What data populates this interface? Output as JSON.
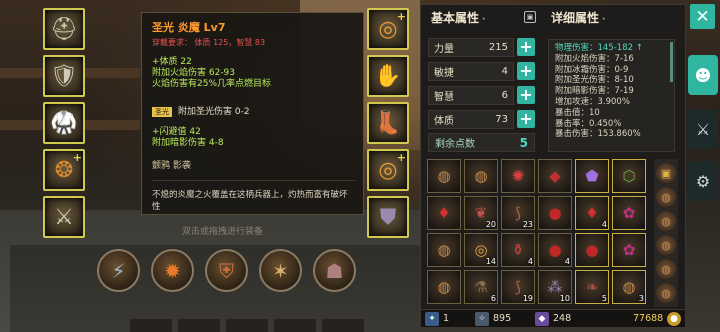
{
  "tooltip": {
    "title": "圣光 炎魔 Lv7",
    "requirement": "穿戴要求：  体质 125，智慧 83",
    "stats": [
      "+体质 22",
      "附加火焰伤害 62-93",
      "火焰伤害有25%几率点燃目标"
    ],
    "gem_tag": "圣光",
    "gem_text": "附加圣光伤害 0-2",
    "stats2": [
      "+闪避值 42",
      "附加暗影伤害 4-8"
    ],
    "sockets": "颤鸦  影袭",
    "description": "不熄的炎魔之火覆盖在这柄兵器上，灼热而富有破坏性",
    "hint": "双击或拖拽进行装备"
  },
  "left_slots": [
    {
      "icon": "helmet-icon",
      "label": "头盔"
    },
    {
      "icon": "shoulder-armor-icon",
      "label": "肩甲"
    },
    {
      "icon": "chest-armor-icon",
      "label": "胸甲"
    },
    {
      "icon": "amulet-icon",
      "label": "项链",
      "plus": "+"
    },
    {
      "icon": "sword-icon",
      "label": "武器"
    }
  ],
  "right_slots": [
    {
      "icon": "ring-icon",
      "label": "戒指",
      "plus": "+"
    },
    {
      "icon": "gloves-icon",
      "label": "手套"
    },
    {
      "icon": "boots-icon",
      "label": "靴子"
    },
    {
      "icon": "ring-icon",
      "label": "戒指",
      "plus": "+"
    },
    {
      "icon": "shield-icon",
      "label": "副手"
    }
  ],
  "skills": [
    "blade-strike-icon",
    "fire-burst-icon",
    "armor-buff-icon",
    "claw-slash-icon",
    "shadow-beast-icon"
  ],
  "panel": {
    "basic_header": "基本属性",
    "detail_header": "详细属性",
    "attributes": [
      {
        "name": "力量",
        "value": "215"
      },
      {
        "name": "敏捷",
        "value": "4"
      },
      {
        "name": "智慧",
        "value": "6"
      },
      {
        "name": "体质",
        "value": "73"
      }
    ],
    "remaining_label": "剩余点数",
    "remaining_value": "5",
    "details": [
      {
        "text": "物理伤害：145-182 ↑",
        "hl": true
      },
      {
        "text": "附加火焰伤害：7-16"
      },
      {
        "text": "附加冰霜伤害：0-9"
      },
      {
        "text": "附加圣光伤害：8-10"
      },
      {
        "text": "附加暗影伤害：7-19"
      },
      {
        "text": "增加攻速：3.900%"
      },
      {
        "text": "暴击值：10"
      },
      {
        "text": "暴击率：0.450%"
      },
      {
        "text": "暴击伤害：153.860%"
      }
    ]
  },
  "inventory": [
    {
      "icon": "pouch-icon",
      "count": ""
    },
    {
      "icon": "pouch-icon",
      "count": ""
    },
    {
      "icon": "red-claw-icon",
      "count": ""
    },
    {
      "icon": "red-gem-icon",
      "count": ""
    },
    {
      "icon": "purple-gem-icon",
      "count": ""
    },
    {
      "icon": "green-gem-icon",
      "count": ""
    },
    {
      "icon": "red-crystal-icon",
      "count": ""
    },
    {
      "icon": "meat-icon",
      "count": "20"
    },
    {
      "icon": "claw-icon",
      "count": "23"
    },
    {
      "icon": "red-orb-icon",
      "count": ""
    },
    {
      "icon": "red-crystal-icon",
      "count": "4"
    },
    {
      "icon": "purple-rune-icon",
      "count": ""
    },
    {
      "icon": "pouch-icon",
      "count": ""
    },
    {
      "icon": "spiral-icon",
      "count": "14"
    },
    {
      "icon": "potion-icon",
      "count": "4"
    },
    {
      "icon": "red-orb-icon",
      "count": "4"
    },
    {
      "icon": "red-orb-icon",
      "count": ""
    },
    {
      "icon": "purple-rune-icon",
      "count": ""
    },
    {
      "icon": "pouch-icon",
      "count": ""
    },
    {
      "icon": "bottle-icon",
      "count": "6"
    },
    {
      "icon": "claw-icon",
      "count": "19"
    },
    {
      "icon": "dust-icon",
      "count": "10"
    },
    {
      "icon": "leaf-icon",
      "count": "5"
    },
    {
      "icon": "pouch-icon",
      "count": "3"
    }
  ],
  "side_icons": [
    "treasure-chest-icon",
    "pouch-icon",
    "pouch-icon",
    "pouch-icon",
    "pouch-icon",
    "pouch-icon"
  ],
  "currency": {
    "a": "1",
    "b": "895",
    "c": "248",
    "gold": "77688"
  },
  "tabs": [
    "close-icon",
    "character-icon",
    "crossed-swords-icon",
    "settings-icon"
  ]
}
